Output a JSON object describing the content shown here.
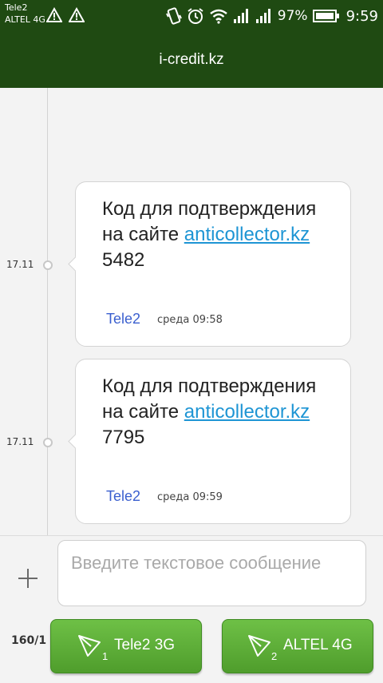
{
  "status_bar": {
    "carrier1": "Tele2",
    "carrier2": "ALTEL 4G",
    "battery_percent": "97%",
    "time": "9:59"
  },
  "header": {
    "title": "i-credit.kz"
  },
  "messages": [
    {
      "date": "17.11",
      "text_before": "Код для подтверждения на сайте ",
      "link": "anticollector.kz",
      "text_after": " 5482",
      "sender": "Tele2",
      "time": "среда 09:58"
    },
    {
      "date": "17.11",
      "text_before": "Код для подтверждения на сайте ",
      "link": "anticollector.kz",
      "text_after": " 7795",
      "sender": "Tele2",
      "time": "среда 09:59"
    }
  ],
  "compose": {
    "placeholder": "Введите текстовое сообщение",
    "counter": "160/1",
    "send_buttons": [
      {
        "sim": "1",
        "label": "Tele2 3G"
      },
      {
        "sim": "2",
        "label": "ALTEL 4G"
      }
    ]
  },
  "colors": {
    "bar": "#1f4a12",
    "send_button": "#5cae36",
    "link": "#1e95d4",
    "sender": "#3a5fcf"
  }
}
